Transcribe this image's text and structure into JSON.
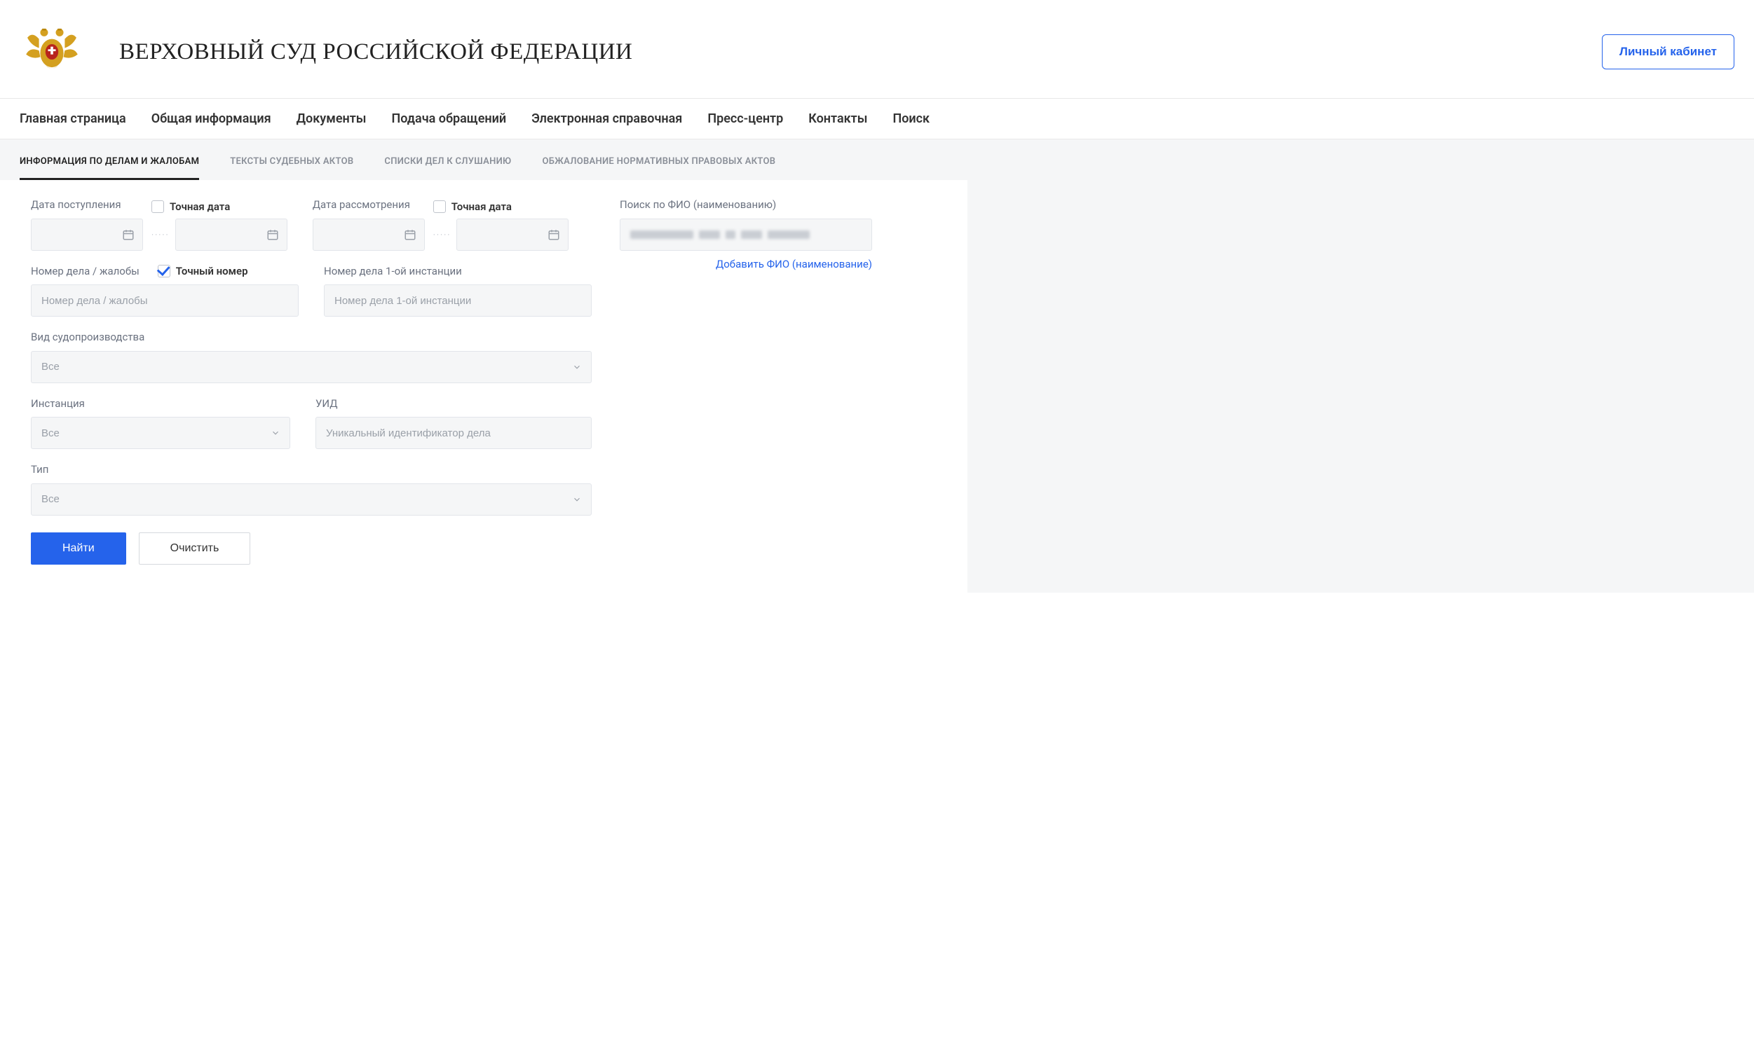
{
  "header": {
    "title": "ВЕРХОВНЫЙ СУД РОССИЙСКОЙ ФЕДЕРАЦИИ",
    "login_button": "Личный кабинет"
  },
  "main_nav": [
    "Главная страница",
    "Общая информация",
    "Документы",
    "Подача обращений",
    "Электронная справочная",
    "Пресс-центр",
    "Контакты",
    "Поиск"
  ],
  "sub_nav": [
    "ИНФОРМАЦИЯ ПО ДЕЛАМ И ЖАЛОБАМ",
    "ТЕКСТЫ СУДЕБНЫХ АКТОВ",
    "СПИСКИ ДЕЛ К СЛУШАНИЮ",
    "ОБЖАЛОВАНИЕ НОРМАТИВНЫХ ПРАВОВЫХ АКТОВ"
  ],
  "form": {
    "date_received_label": "Дата поступления",
    "exact_date_label": "Точная дата",
    "date_review_label": "Дата рассмотрения",
    "case_number_label": "Номер дела / жалобы",
    "exact_number_label": "Точный номер",
    "case_number_placeholder": "Номер дела / жалобы",
    "first_instance_label": "Номер дела 1-ой инстанции",
    "first_instance_placeholder": "Номер дела 1-ой инстанции",
    "proceeding_type_label": "Вид судопроизводства",
    "all_option": "Все",
    "instance_label": "Инстанция",
    "uid_label": "УИД",
    "uid_placeholder": "Уникальный идентификатор дела",
    "type_label": "Тип",
    "search_button": "Найти",
    "clear_button": "Очистить"
  },
  "side": {
    "fio_label": "Поиск по ФИО (наименованию)",
    "add_fio_link": "Добавить ФИО (наименование)"
  }
}
